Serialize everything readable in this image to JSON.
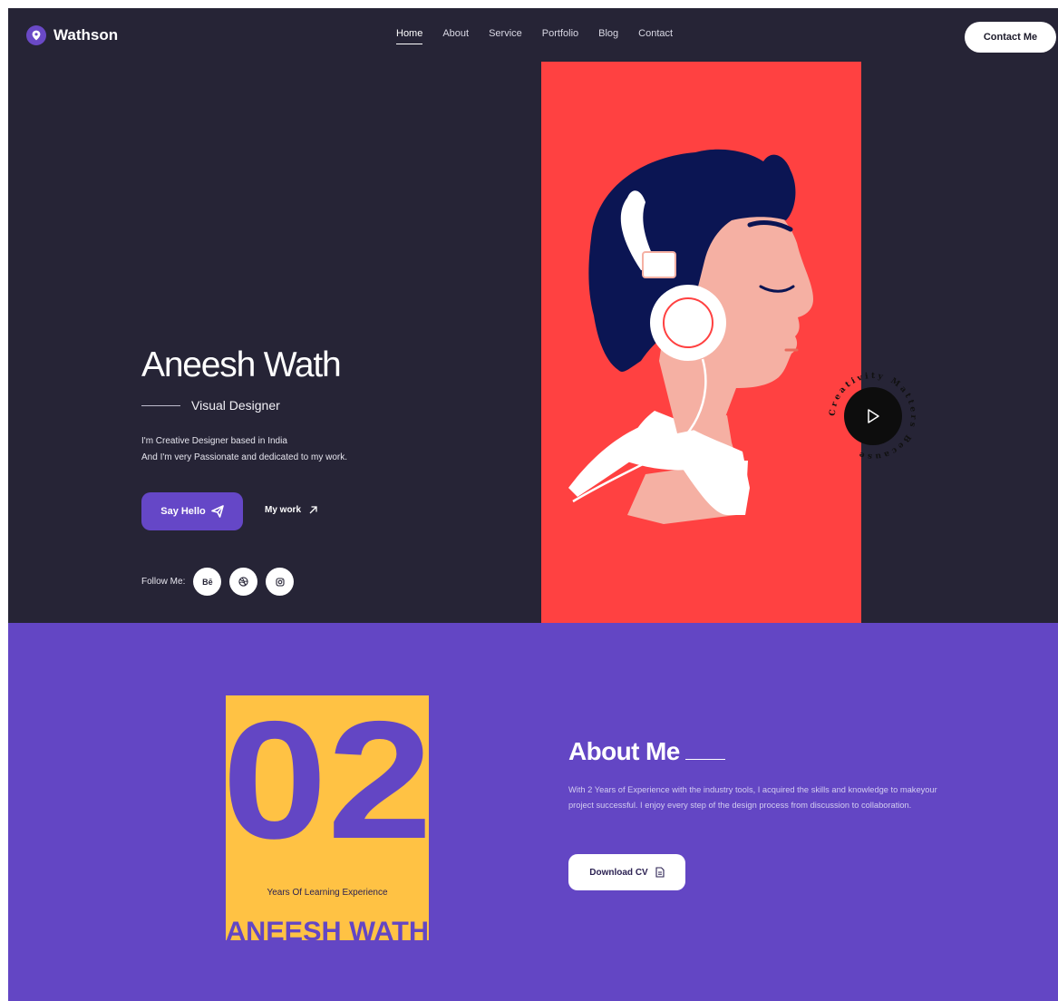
{
  "brand": {
    "name": "Wathson",
    "accent": "#6547c7"
  },
  "nav": {
    "items": [
      {
        "label": "Home",
        "active": true
      },
      {
        "label": "About",
        "active": false
      },
      {
        "label": "Service",
        "active": false
      },
      {
        "label": "Portfolio",
        "active": false
      },
      {
        "label": "Blog",
        "active": false
      },
      {
        "label": "Contact",
        "active": false
      }
    ],
    "contact_button": "Contact Me"
  },
  "hero": {
    "name": "Aneesh Wath",
    "role": "Visual Designer",
    "intro_lines": [
      "I'm Creative Designer based in India",
      "And I'm very Passionate and dedicated to my work."
    ],
    "primary_button": "Say Hello",
    "secondary_link": "My work",
    "follow_label": "Follow Me:",
    "socials": [
      {
        "icon": "behance-icon",
        "label": "Bē"
      },
      {
        "icon": "dribbble-icon",
        "label": ""
      },
      {
        "icon": "instagram-icon",
        "label": ""
      }
    ],
    "art_background": "#ff4141",
    "badge_text": "Creativity Matters Because"
  },
  "about": {
    "years": "02",
    "years_label": "Years Of Learning Experience",
    "watermark": "ANEESH WATH",
    "title": "About Me",
    "text": "With 2 Years of Experience with the industry tools, I acquired the skills and knowledge to makeyour project successful. I enjoy every step of the design process from discussion to collaboration.",
    "cv_button": "Download CV",
    "background": "#6346c4",
    "card_color": "#ffc244"
  }
}
